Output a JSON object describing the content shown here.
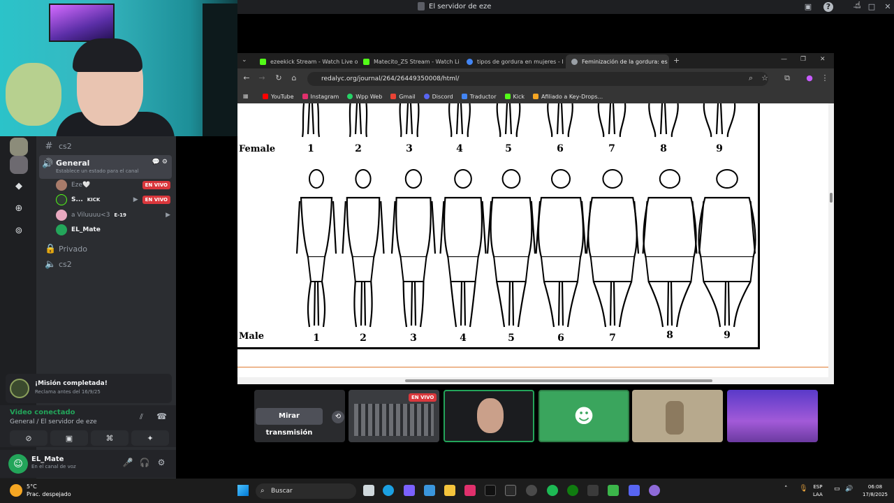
{
  "window": {
    "title": "El servidor de eze",
    "controls": [
      "minimize-icon",
      "maximize-icon",
      "close-icon"
    ]
  },
  "sidebar": {
    "channels": [
      {
        "name": "cs2",
        "type": "text"
      },
      {
        "name": "General",
        "type": "voice",
        "status_hint": "Establece un estado para el canal"
      },
      {
        "name": "Privado",
        "type": "locked"
      },
      {
        "name": "cs2",
        "type": "voice"
      }
    ],
    "voice_users": [
      {
        "name": "Eze🤍",
        "badge": "EN VIVO"
      },
      {
        "name": "S...",
        "extra": "KICK",
        "badge": "EN VIVO"
      },
      {
        "name": "a Viluuuu<3",
        "extra": "E-19"
      },
      {
        "name": "EL_Mate"
      }
    ]
  },
  "mission": {
    "title": "¡Misión completada!",
    "subtitle": "Reclama antes del 16/9/25"
  },
  "voice_panel": {
    "status": "Video conectado",
    "location": "General / El servidor de eze"
  },
  "user": {
    "name": "EL_Mate",
    "status": "En el canal de voz"
  },
  "browser": {
    "tabs": [
      {
        "title": "ezeekick Stream - Watch Live o",
        "color": "#53fc18"
      },
      {
        "title": "Matecito_ZS Stream - Watch Li",
        "color": "#53fc18"
      },
      {
        "title": "tipos de gordura en mujeres - I",
        "color": "#4285f4"
      },
      {
        "title": "Feminización de la gordura: es",
        "color": "#9aa0a6"
      }
    ],
    "url": "redalyc.org/journal/264/26449350008/html/",
    "bookmarks": [
      {
        "label": "YouTube",
        "color": "#ff0000"
      },
      {
        "label": "Instagram",
        "color": "#e1306c"
      },
      {
        "label": "Wpp Web",
        "color": "#25d366"
      },
      {
        "label": "Gmail",
        "color": "#ea4335"
      },
      {
        "label": "Discord",
        "color": "#5865f2"
      },
      {
        "label": "Traductor",
        "color": "#4285f4"
      },
      {
        "label": "Kick",
        "color": "#53fc18"
      },
      {
        "label": "Afiliado a Key-Drops...",
        "color": "#f5a623"
      }
    ]
  },
  "figure": {
    "female_label": "Female",
    "male_label": "Male",
    "female_numbers": [
      "1",
      "2",
      "3",
      "4",
      "5",
      "6",
      "7",
      "8",
      "9"
    ],
    "male_numbers": [
      "1",
      "2",
      "3",
      "4",
      "5",
      "6",
      "7",
      "8",
      "9"
    ]
  },
  "stream_tiles": {
    "watch_label": "Mirar transmisión",
    "live_badge": "EN VIVO"
  },
  "taskbar": {
    "temp": "5°C",
    "weather": "Prac. despejado",
    "search_placeholder": "Buscar",
    "lang1": "ESP",
    "lang2": "LAA",
    "time": "06:08",
    "date": "17/8/2025"
  }
}
